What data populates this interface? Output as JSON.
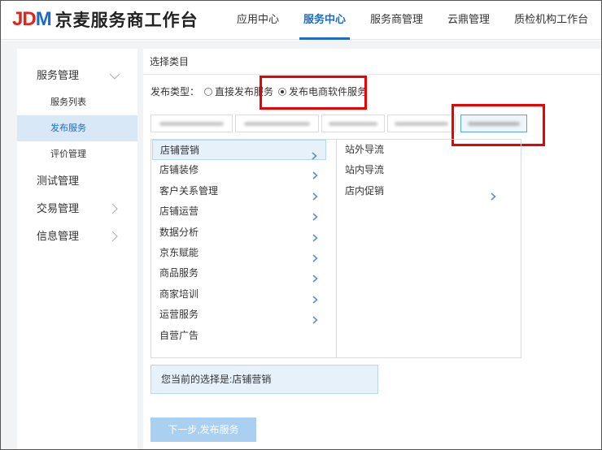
{
  "header": {
    "logo_jd": "JD",
    "logo_m": "M",
    "logo_text": "京麦服务商工作台",
    "nav": [
      {
        "label": "应用中心",
        "active": false
      },
      {
        "label": "服务中心",
        "active": true
      },
      {
        "label": "服务商管理",
        "active": false
      },
      {
        "label": "云鼎管理",
        "active": false
      },
      {
        "label": "质检机构工作台",
        "active": false
      }
    ]
  },
  "sidebar": {
    "group_service": "服务管理",
    "sub_service_list": "服务列表",
    "sub_publish": "发布服务",
    "sub_review": "评价管理",
    "group_test": "测试管理",
    "group_trade": "交易管理",
    "group_info": "信息管理"
  },
  "content": {
    "title": "选择类目",
    "publish_type_label": "发布类型：",
    "option_direct": "直接发布服务",
    "option_ecommerce": "发布电商软件服务",
    "categories": [
      {
        "label": "店铺营销",
        "has_children": true,
        "active": true
      },
      {
        "label": "店铺装修",
        "has_children": true,
        "active": false
      },
      {
        "label": "客户关系管理",
        "has_children": true,
        "active": false
      },
      {
        "label": "店铺运营",
        "has_children": true,
        "active": false
      },
      {
        "label": "数据分析",
        "has_children": true,
        "active": false
      },
      {
        "label": "京东赋能",
        "has_children": true,
        "active": false
      },
      {
        "label": "商品服务",
        "has_children": true,
        "active": false
      },
      {
        "label": "商家培训",
        "has_children": true,
        "active": false
      },
      {
        "label": "运营服务",
        "has_children": true,
        "active": false
      },
      {
        "label": "自营广告",
        "has_children": false,
        "active": false
      }
    ],
    "subcategories": [
      {
        "label": "站外导流",
        "has_children": false
      },
      {
        "label": "站内导流",
        "has_children": false
      },
      {
        "label": "店内促销",
        "has_children": true
      }
    ],
    "summary": "您当前的选择是:店铺营销",
    "next_button": "下一步,发布服务"
  },
  "colors": {
    "accent": "#1d6bc8",
    "logo_red": "#e1251b",
    "highlight_red": "#e00000"
  }
}
